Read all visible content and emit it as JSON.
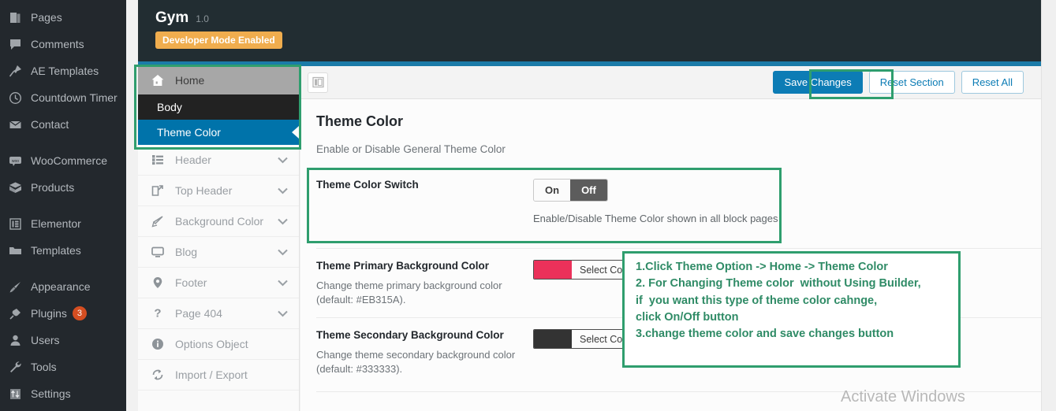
{
  "wp_sidebar": {
    "items": [
      {
        "label": "Pages",
        "icon": "pages-icon",
        "badge": ""
      },
      {
        "label": "Comments",
        "icon": "comments-icon",
        "badge": ""
      },
      {
        "label": "AE Templates",
        "icon": "pin-icon",
        "badge": ""
      },
      {
        "label": "Countdown Timer",
        "icon": "clock-icon",
        "badge": ""
      },
      {
        "label": "Contact",
        "icon": "mail-icon",
        "badge": ""
      },
      {
        "label": "WooCommerce",
        "icon": "woo-icon",
        "badge": ""
      },
      {
        "label": "Products",
        "icon": "box-icon",
        "badge": ""
      },
      {
        "label": "Elementor",
        "icon": "elementor-icon",
        "badge": ""
      },
      {
        "label": "Templates",
        "icon": "folder-icon",
        "badge": ""
      },
      {
        "label": "Appearance",
        "icon": "brush-icon",
        "badge": ""
      },
      {
        "label": "Plugins",
        "icon": "plug-icon",
        "badge": "3"
      },
      {
        "label": "Users",
        "icon": "user-icon",
        "badge": ""
      },
      {
        "label": "Tools",
        "icon": "wrench-icon",
        "badge": ""
      },
      {
        "label": "Settings",
        "icon": "sliders-icon",
        "badge": ""
      }
    ]
  },
  "panel_header": {
    "title": "Gym",
    "version": "1.0",
    "dev_badge": "Developer Mode Enabled"
  },
  "settings_nav": {
    "home": {
      "label": "Home",
      "icon": "home-icon"
    },
    "sub_items": [
      {
        "label": "Body",
        "active": false
      },
      {
        "label": "Theme Color",
        "active": true
      }
    ],
    "sections": [
      {
        "label": "Header",
        "icon": "list-icon",
        "caret": "chevron-down-icon"
      },
      {
        "label": "Top Header",
        "icon": "export-icon",
        "caret": "chevron-down-icon"
      },
      {
        "label": "Background Color",
        "icon": "pencil-icon",
        "caret": "chevron-down-icon"
      },
      {
        "label": "Blog",
        "icon": "monitor-icon",
        "caret": "chevron-down-icon"
      },
      {
        "label": "Footer",
        "icon": "pin-location-icon",
        "caret": "chevron-down-icon"
      },
      {
        "label": "Page 404",
        "icon": "question-icon",
        "caret": "chevron-down-icon"
      },
      {
        "label": "Options Object",
        "icon": "info-icon",
        "caret": ""
      },
      {
        "label": "Import / Export",
        "icon": "sync-icon",
        "caret": ""
      }
    ]
  },
  "toolbar": {
    "layout_toggle_icon": "layout-icon",
    "save_label": "Save Changes",
    "reset_section_label": "Reset Section",
    "reset_all_label": "Reset All",
    "primary_color": "#0c7cb5"
  },
  "content": {
    "title": "Theme Color",
    "subtitle": "Enable or Disable General Theme Color",
    "switch_field": {
      "name": "Theme Color Switch",
      "on_label": "On",
      "off_label": "Off",
      "selected": "Off",
      "help": "Enable/Disable Theme Color shown in all block pages"
    },
    "color_fields": [
      {
        "name": "Theme Primary Background Color",
        "desc": "Change theme primary background color (default: #EB315A).",
        "button_label": "Select Color",
        "swatch_color": "#EB315A"
      },
      {
        "name": "Theme Secondary Background Color",
        "desc": "Change theme secondary background color (default: #333333).",
        "button_label": "Select Color",
        "swatch_color": "#333333"
      }
    ]
  },
  "annotation": {
    "note_text": "1.Click Theme Option -> Home -> Theme Color\n2. For Changing Theme color  without Using Builder,\nif  you want this type of theme color cahnge,\nclick On/Off button\n3.change theme color and save changes button",
    "highlight_color": "#2f9e6e"
  },
  "watermark": {
    "text": "Activate Windows"
  }
}
